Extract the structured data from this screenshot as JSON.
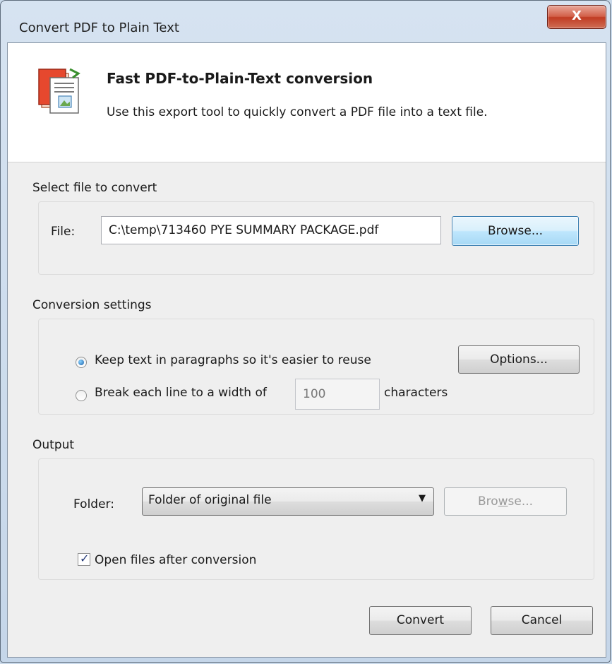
{
  "window": {
    "title": "Convert PDF to Plain Text",
    "close_glyph": "X"
  },
  "header": {
    "title": "Fast PDF-to-Plain-Text conversion",
    "description": "Use this export tool to quickly convert a PDF file into a text file.",
    "icon": "pdf-to-text-icon"
  },
  "select_file": {
    "group_label": "Select file to convert",
    "file_label": "File:",
    "file_value": "C:\\temp\\713460 PYE SUMMARY PACKAGE.pdf",
    "browse_label": "Browse..."
  },
  "conversion": {
    "group_label": "Conversion settings",
    "option_paragraphs": "Keep text in paragraphs so it's easier to reuse",
    "option_break_prefix": "Break each line to a width of",
    "width_value": "100",
    "option_break_suffix": "characters",
    "selected_option": "paragraphs",
    "options_button": "Options..."
  },
  "output": {
    "group_label": "Output",
    "folder_label": "Folder:",
    "folder_selected": "Folder of original file",
    "browse_pre": "Bro",
    "browse_ul": "w",
    "browse_post": "se...",
    "open_after_label": "Open files after conversion",
    "open_after_checked": true
  },
  "footer": {
    "convert_label": "Convert",
    "cancel_label": "Cancel"
  },
  "colors": {
    "accent_blue": "#3c7fb1",
    "close_red": "#c03b22",
    "window_frame": "#c5d6e9"
  }
}
